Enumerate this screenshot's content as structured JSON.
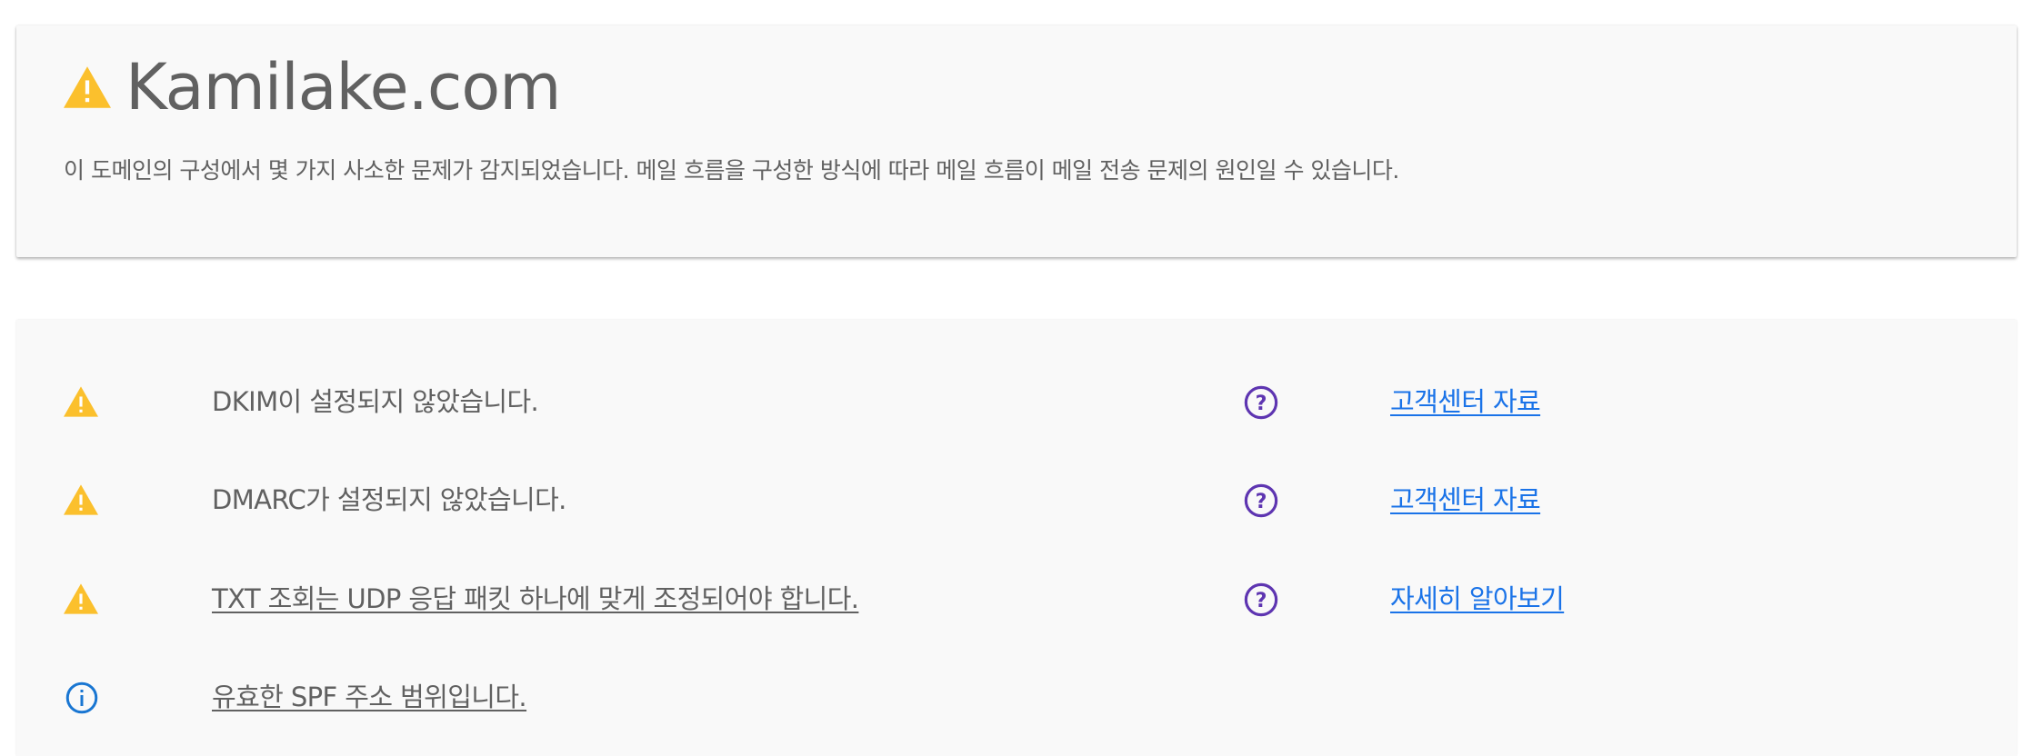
{
  "header": {
    "domain": "Kamilake.com",
    "summary": "이 도메인의 구성에서 몇 가지 사소한 문제가 감지되었습니다. 메일 흐름을 구성한 방식에 따라 메일 흐름이 메일 전송 문제의 원인일 수 있습니다.",
    "status_icon": "warning-icon"
  },
  "colors": {
    "warning": "#fbc02d",
    "info": "#1976d2",
    "help": "#5e35b1",
    "link": "#1a73e8",
    "text": "#616161",
    "card_background": "#f9f9f9"
  },
  "results": [
    {
      "status": "warning",
      "icon": "warning-icon",
      "text": "DKIM이 설정되지 않았습니다.",
      "help_icon": "help-circle-icon",
      "link_label": "고객센터 자료"
    },
    {
      "status": "warning",
      "icon": "warning-icon",
      "text": "DMARC가 설정되지 않았습니다.",
      "help_icon": "help-circle-icon",
      "link_label": "고객센터 자료"
    },
    {
      "status": "warning",
      "icon": "warning-icon",
      "text": "TXT 조회는 UDP 응답 패킷 하나에 맞게 조정되어야 합니다.",
      "help_icon": "help-circle-icon",
      "link_label": "자세히 알아보기"
    },
    {
      "status": "info",
      "icon": "info-circle-icon",
      "text": "유효한 SPF 주소 범위입니다."
    }
  ]
}
